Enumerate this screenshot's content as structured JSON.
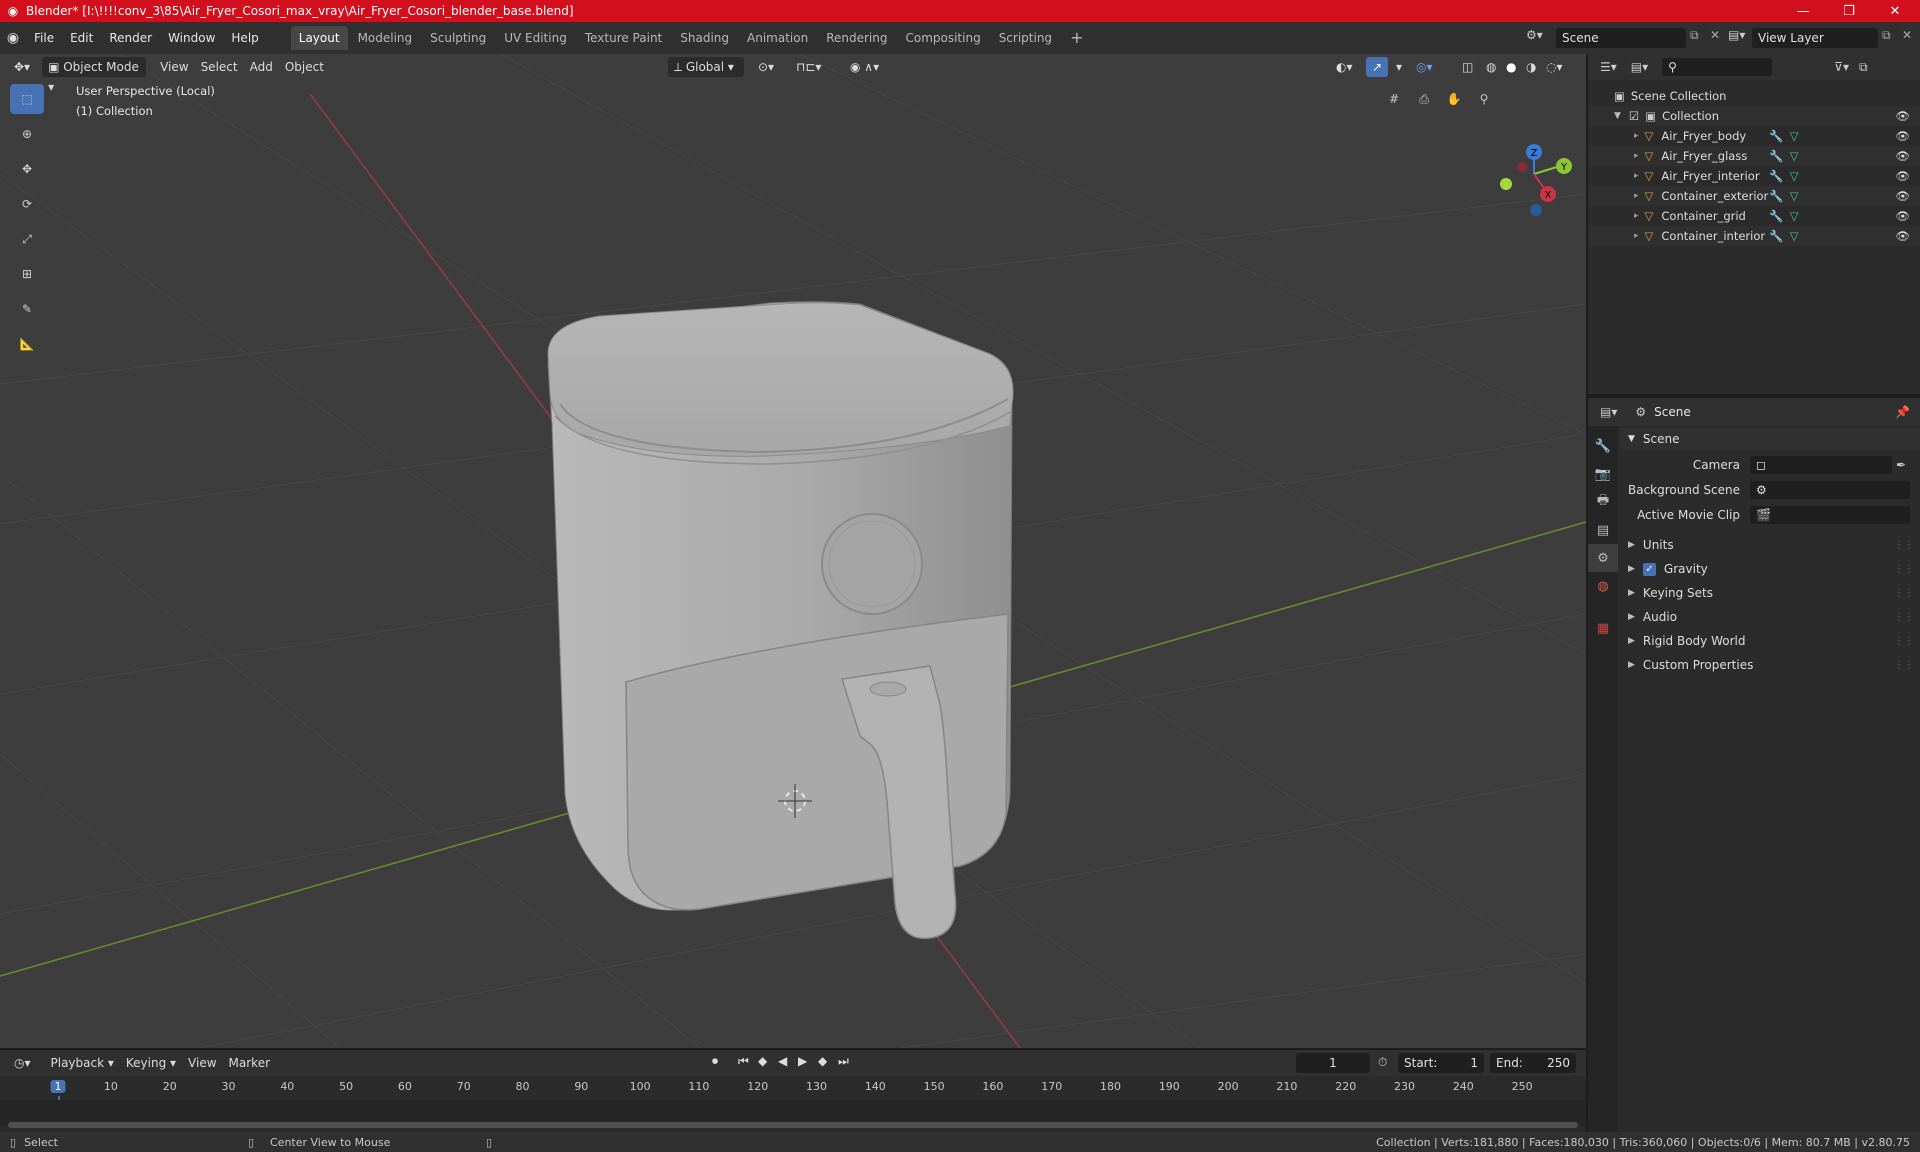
{
  "window": {
    "title": "Blender* [I:\\!!!!conv_3\\85\\Air_Fryer_Cosori_max_vray\\Air_Fryer_Cosori_blender_base.blend]"
  },
  "menu": [
    "File",
    "Edit",
    "Render",
    "Window",
    "Help"
  ],
  "workspaces": [
    "Layout",
    "Modeling",
    "Sculpting",
    "UV Editing",
    "Texture Paint",
    "Shading",
    "Animation",
    "Rendering",
    "Compositing",
    "Scripting"
  ],
  "active_workspace": "Layout",
  "scene_field": "Scene",
  "view_layer_field": "View Layer",
  "viewport": {
    "mode": "Object Mode",
    "menus": [
      "View",
      "Select",
      "Add",
      "Object"
    ],
    "transform_orientation": "Global",
    "overlay_line1": "User Perspective (Local)",
    "overlay_line2": "(1) Collection",
    "gizmo_axes": {
      "z": "Z",
      "y": "Y",
      "x": "X"
    }
  },
  "outliner": {
    "root": "Scene Collection",
    "collection": "Collection",
    "objects": [
      "Air_Fryer_body",
      "Air_Fryer_glass",
      "Air_Fryer_interior",
      "Container_exterior",
      "Container_grid",
      "Container_interior"
    ]
  },
  "properties": {
    "header": "Scene",
    "panel_title": "Scene",
    "camera_label": "Camera",
    "background_scene_label": "Background Scene",
    "active_movie_clip_label": "Active Movie Clip",
    "sections": [
      "Units",
      "Gravity",
      "Keying Sets",
      "Audio",
      "Rigid Body World",
      "Custom Properties"
    ],
    "gravity_checked": true
  },
  "timeline": {
    "menus": [
      "Playback",
      "Keying",
      "View",
      "Marker"
    ],
    "current_frame": "1",
    "start_label": "Start:",
    "start": "1",
    "end_label": "End:",
    "end": "250",
    "ticks": [
      "1",
      "10",
      "20",
      "30",
      "40",
      "50",
      "60",
      "70",
      "80",
      "90",
      "100",
      "110",
      "120",
      "130",
      "140",
      "150",
      "160",
      "170",
      "180",
      "190",
      "200",
      "210",
      "220",
      "230",
      "240",
      "250"
    ]
  },
  "statusbar": {
    "left_action": "Select",
    "middle_action": "Center View to Mouse",
    "stats": "Collection | Verts:181,880 | Faces:180,030 | Tris:360,060 | Objects:0/6 | Mem: 80.7 MB | v2.80.75"
  },
  "colors": {
    "title_bar": "#d20f1c",
    "accent": "#4772b3",
    "x_axis": "#cc3344",
    "y_axis": "#88c633",
    "z_axis": "#3a7bd5"
  }
}
